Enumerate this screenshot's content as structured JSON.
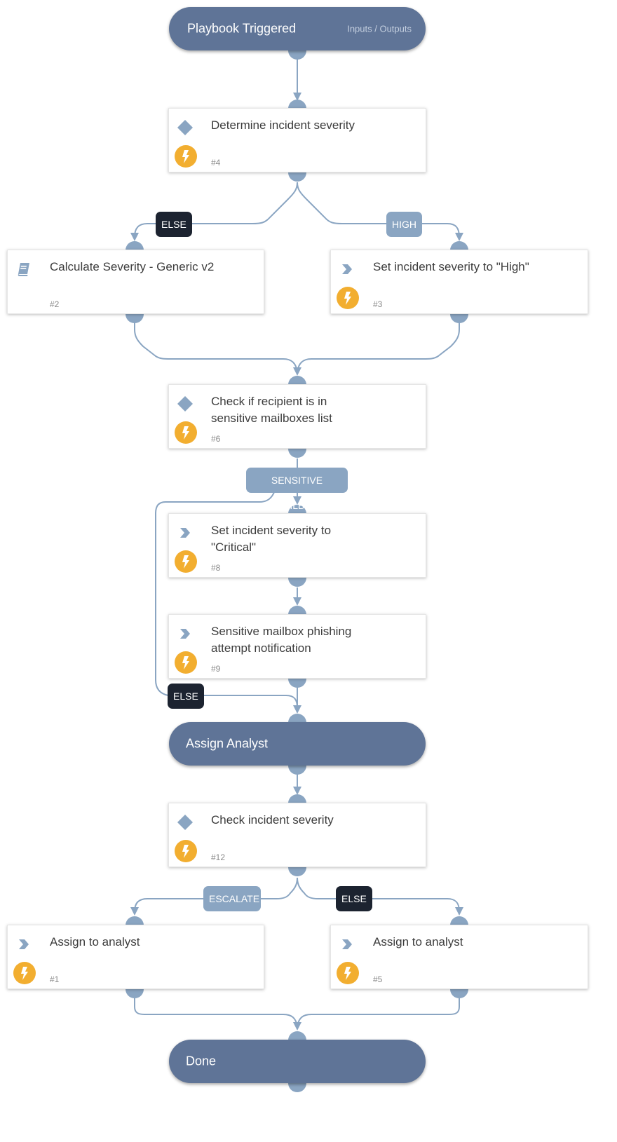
{
  "colors": {
    "section_bg": "#5f7497",
    "edge": "#8aa5c2",
    "automation_badge": "#f2ae30",
    "else_label_bg": "#1c2330",
    "condition_label_bg": "#8aa5c2"
  },
  "sections": {
    "start": {
      "title": "Playbook Triggered",
      "io_link": "Inputs / Outputs"
    },
    "assign": {
      "title": "Assign Analyst"
    },
    "done": {
      "title": "Done"
    }
  },
  "tasks": {
    "t4": {
      "name": "Determine incident severity",
      "num": "#4",
      "type_icon": "diamond-icon",
      "automated": true
    },
    "t2": {
      "name": "Calculate Severity - Generic v2",
      "num": "#2",
      "type_icon": "book-icon",
      "automated": false
    },
    "t3": {
      "name": "Set incident severity to \"High\"",
      "num": "#3",
      "type_icon": "chevron-right-icon",
      "automated": true
    },
    "t6": {
      "name": "Check if recipient is in sensitive mailboxes list",
      "num": "#6",
      "type_icon": "diamond-icon",
      "automated": true
    },
    "t8": {
      "name": "Set incident severity to \"Critical\"",
      "num": "#8",
      "type_icon": "chevron-right-icon",
      "automated": true
    },
    "t9": {
      "name": "Sensitive mailbox phishing attempt notification",
      "num": "#9",
      "type_icon": "chevron-right-icon",
      "automated": true
    },
    "t12": {
      "name": "Check incident severity",
      "num": "#12",
      "type_icon": "diamond-icon",
      "automated": true
    },
    "t1": {
      "name": "Assign to analyst",
      "num": "#1",
      "type_icon": "chevron-right-icon",
      "automated": true
    },
    "t5": {
      "name": "Assign to analyst",
      "num": "#5",
      "type_icon": "chevron-right-icon",
      "automated": true
    }
  },
  "labels": {
    "else1": "ELSE",
    "high": "HIGH",
    "sensitive": "SENSITIVE MAILBOX",
    "else2": "ELSE",
    "escalate": "ESCALATE",
    "else3": "ELSE"
  }
}
